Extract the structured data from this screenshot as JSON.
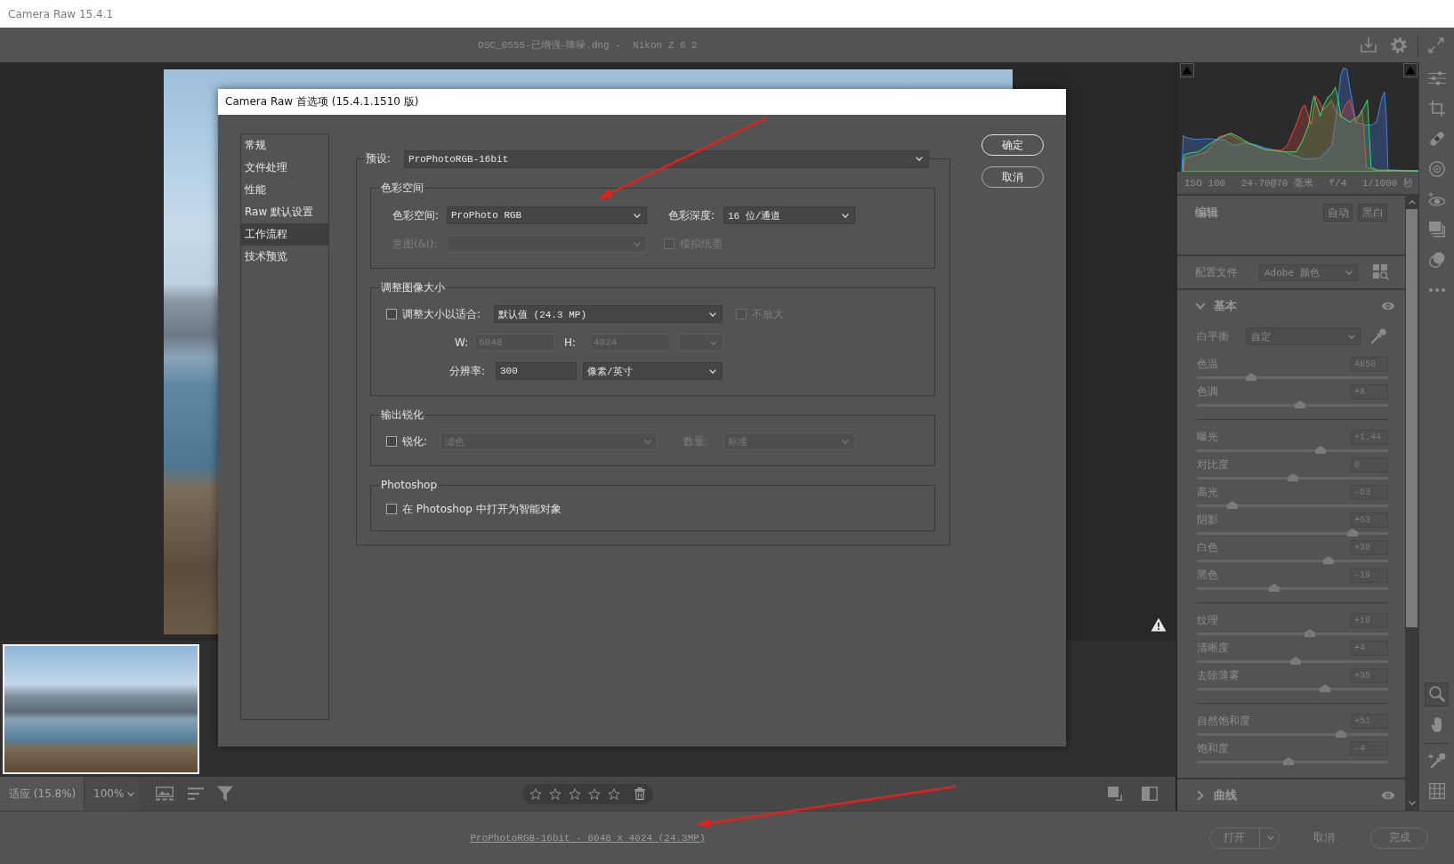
{
  "window": {
    "title": "Camera Raw 15.4.1"
  },
  "header": {
    "file_info": "DSC_0555-已增强-降噪.dng -  Nikon Z 6 2"
  },
  "canvas_toolbar": {
    "zoom_fit": "适应 (15.8%)",
    "zoom_level": "100%",
    "rating": {
      "stars": 0
    }
  },
  "right_panel": {
    "camera_info": [
      "ISO 100",
      "24-70@70 毫米",
      "f/4",
      "1/1000 秒"
    ],
    "edit": {
      "title": "编辑",
      "buttons": [
        "自动",
        "黑白"
      ]
    },
    "profile": {
      "label": "配置文件",
      "value": "Adobe 颜色"
    },
    "basic": {
      "title": "基本",
      "expanded": true,
      "white_balance": {
        "label": "白平衡",
        "value": "自定"
      },
      "slider_groups": [
        {
          "sliders": [
            {
              "label": "色温",
              "value": "4850",
              "level": 0.285
            },
            {
              "label": "色调",
              "value": "+8",
              "level": 0.54
            }
          ]
        },
        {
          "sliders": [
            {
              "label": "曝光",
              "value": "+1.44",
              "level": 0.645
            },
            {
              "label": "对比度",
              "value": "0",
              "level": 0.5
            },
            {
              "label": "高光",
              "value": "-63",
              "level": 0.187
            },
            {
              "label": "阴影",
              "value": "+63",
              "level": 0.813
            },
            {
              "label": "白色",
              "value": "+38",
              "level": 0.69
            },
            {
              "label": "黑色",
              "value": "-19",
              "level": 0.405
            }
          ]
        },
        {
          "sliders": [
            {
              "label": "纹理",
              "value": "+19",
              "level": 0.593
            },
            {
              "label": "清晰度",
              "value": "+4",
              "level": 0.518
            },
            {
              "label": "去除薄雾",
              "value": "+35",
              "level": 0.672
            }
          ]
        },
        {
          "sliders": [
            {
              "label": "自然饱和度",
              "value": "+51",
              "level": 0.755
            },
            {
              "label": "饱和度",
              "value": "-4",
              "level": 0.48
            }
          ]
        }
      ]
    },
    "curve": {
      "title": "曲线",
      "expanded": false
    }
  },
  "status_bar": {
    "workflow_link": "ProPhotoRGB-16bit - 6048 x 4024 (24.3MP)",
    "buttons": [
      {
        "label": "打开",
        "kind": "split"
      },
      {
        "label": "取消",
        "kind": "text"
      },
      {
        "label": "完成",
        "kind": "outline"
      }
    ]
  },
  "dialog": {
    "title": "Camera Raw 首选项 (15.4.1.1510 版)",
    "nav": [
      {
        "label": "常规",
        "selected": false
      },
      {
        "label": "文件处理",
        "selected": false
      },
      {
        "label": "性能",
        "selected": false
      },
      {
        "label": "Raw 默认设置",
        "selected": false
      },
      {
        "label": "工作流程",
        "selected": true
      },
      {
        "label": "技术预览",
        "selected": false
      }
    ],
    "preset": {
      "label": "预设:",
      "value": "ProPhotoRGB-16bit"
    },
    "sections": [
      {
        "title": "色彩空间",
        "lines": [
          {
            "controls": [
              {
                "kind": "label",
                "text": "色彩空间:",
                "disabled": false
              },
              {
                "kind": "select",
                "value": "ProPhoto RGB",
                "disabled": false
              },
              {
                "kind": "label",
                "text": "色彩深度:",
                "disabled": false
              },
              {
                "kind": "select",
                "value": "16 位/通道",
                "disabled": false
              }
            ]
          },
          {
            "controls": [
              {
                "kind": "label",
                "text": "意图(&I):",
                "disabled": true
              },
              {
                "kind": "select",
                "disabled": true
              },
              {
                "kind": "checkbox",
                "label": "模拟纸墨",
                "checked": false,
                "disabled": true
              }
            ]
          }
        ]
      },
      {
        "title": "调整图像大小",
        "lines": [
          {
            "controls": [
              {
                "kind": "checkbox",
                "label": "调整大小以适合:",
                "checked": false,
                "disabled": false
              },
              {
                "kind": "select",
                "value": "默认值 (24.3 MP)",
                "disabled": false
              },
              {
                "kind": "checkbox",
                "label": "不放大",
                "checked": false,
                "disabled": true
              }
            ]
          },
          {
            "controls": [
              {
                "kind": "label",
                "text": "W:",
                "disabled": false
              },
              {
                "kind": "field",
                "value": "6048",
                "disabled": true
              },
              {
                "kind": "label",
                "text": "H:",
                "disabled": false
              },
              {
                "kind": "field",
                "value": "4024",
                "disabled": true
              },
              {
                "kind": "select",
                "disabled": true
              }
            ]
          },
          {
            "controls": [
              {
                "kind": "label",
                "text": "分辨率:",
                "disabled": false
              },
              {
                "kind": "field",
                "value": "300",
                "disabled": false
              },
              {
                "kind": "select",
                "value": "像素/英寸",
                "disabled": false
              }
            ]
          }
        ]
      },
      {
        "title": "输出锐化",
        "lines": [
          {
            "controls": [
              {
                "kind": "checkbox",
                "label": "锐化:",
                "checked": false,
                "disabled": false
              },
              {
                "kind": "select",
                "value": "滤色",
                "disabled": true
              },
              {
                "kind": "label",
                "text": "数量:",
                "disabled": true
              },
              {
                "kind": "select",
                "value": "标准",
                "disabled": true
              }
            ]
          }
        ]
      },
      {
        "title": "Photoshop",
        "lines": [
          {
            "controls": [
              {
                "kind": "checkbox",
                "label": "在 Photoshop 中打开为智能对象",
                "checked": false,
                "disabled": false
              }
            ]
          }
        ]
      }
    ],
    "buttons": [
      {
        "label": "确定",
        "default": true
      },
      {
        "label": "取消",
        "default": false
      }
    ]
  }
}
